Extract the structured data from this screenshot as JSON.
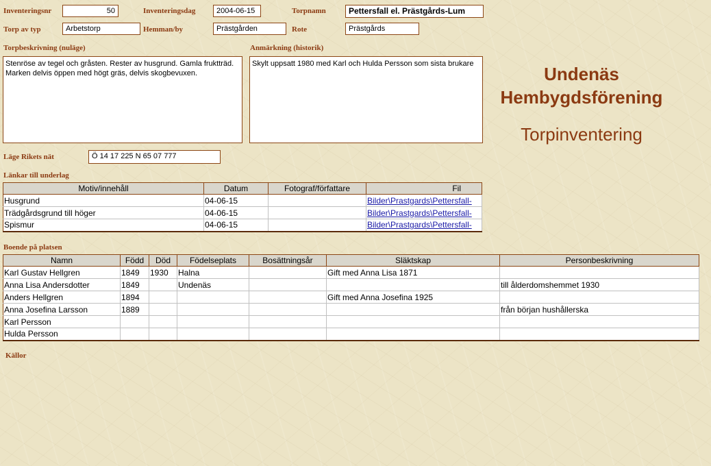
{
  "form": {
    "inventeringsnr_label": "Inventeringsnr",
    "inventeringsnr": "50",
    "inventeringsdag_label": "Inventeringsdag",
    "inventeringsdag": "2004-06-15",
    "torpnamn_label": "Torpnamn",
    "torpnamn": "Pettersfall el. Prästgårds-Lum",
    "torp_av_typ_label": "Torp av typ",
    "torp_av_typ": "Arbetstorp",
    "hemman_label": "Hemman/by",
    "hemman": "Prästgården",
    "rote_label": "Rote",
    "rote": "Prästgårds",
    "torpbeskrivning_label": "Torpbeskrivning (nuläge)",
    "torpbeskrivning": "Stenröse av tegel och gråsten. Rester av husgrund. Gamla fruktträd. Marken delvis öppen med högt gräs, delvis skogbevuxen.",
    "anmarkning_label": "Anmärkning (historik)",
    "anmarkning": "Skylt uppsatt 1980 med Karl och Hulda Persson som sista brukare",
    "lage_label": "Läge Rikets nät",
    "lage": "Ö 14 17 225 N 65 07 777"
  },
  "org": {
    "line1": "Undenäs",
    "line2": "Hembygdsförening",
    "subtitle": "Torpinventering"
  },
  "links": {
    "heading": "Länkar till underlag",
    "headers": [
      "Motiv/innehåll",
      "Datum",
      "Fotograf/författare",
      "Fil"
    ],
    "rows": [
      {
        "motiv": "Husgrund",
        "datum": "04-06-15",
        "fotograf": "",
        "fil": "Bilder\\Prastgards\\Pettersfall-"
      },
      {
        "motiv": "Trädgårdsgrund till höger",
        "datum": "04-06-15",
        "fotograf": "",
        "fil": "Bilder\\Prastgards\\Pettersfall-"
      },
      {
        "motiv": "Spismur",
        "datum": "04-06-15",
        "fotograf": "",
        "fil": "Bilder\\Prastgards\\Pettersfall-"
      }
    ]
  },
  "residents": {
    "heading": "Boende på platsen",
    "headers": [
      "Namn",
      "Född",
      "Död",
      "Födelseplats",
      "Bosättningsår",
      "Släktskap",
      "Personbeskrivning"
    ],
    "rows": [
      {
        "namn": "Karl Gustav Hellgren",
        "fodd": "1849",
        "dod": "1930",
        "fodelseplats": "Halna",
        "bosattning": "",
        "slaktskap": "Gift med Anna Lisa 1871",
        "beskrivning": ""
      },
      {
        "namn": "Anna Lisa Andersdotter",
        "fodd": "1849",
        "dod": "",
        "fodelseplats": "Undenäs",
        "bosattning": "",
        "slaktskap": "",
        "beskrivning": "till ålderdomshemmet 1930"
      },
      {
        "namn": "Anders Hellgren",
        "fodd": "1894",
        "dod": "",
        "fodelseplats": "",
        "bosattning": "",
        "slaktskap": "Gift med Anna Josefina 1925",
        "beskrivning": ""
      },
      {
        "namn": "Anna Josefina Larsson",
        "fodd": "1889",
        "dod": "",
        "fodelseplats": "",
        "bosattning": "",
        "slaktskap": "",
        "beskrivning": "från början hushållerska"
      },
      {
        "namn": "Karl Persson",
        "fodd": "",
        "dod": "",
        "fodelseplats": "",
        "bosattning": "",
        "slaktskap": "",
        "beskrivning": ""
      },
      {
        "namn": "Hulda Persson",
        "fodd": "",
        "dod": "",
        "fodelseplats": "",
        "bosattning": "",
        "slaktskap": "",
        "beskrivning": ""
      }
    ]
  },
  "sources": {
    "heading": "Källor"
  }
}
